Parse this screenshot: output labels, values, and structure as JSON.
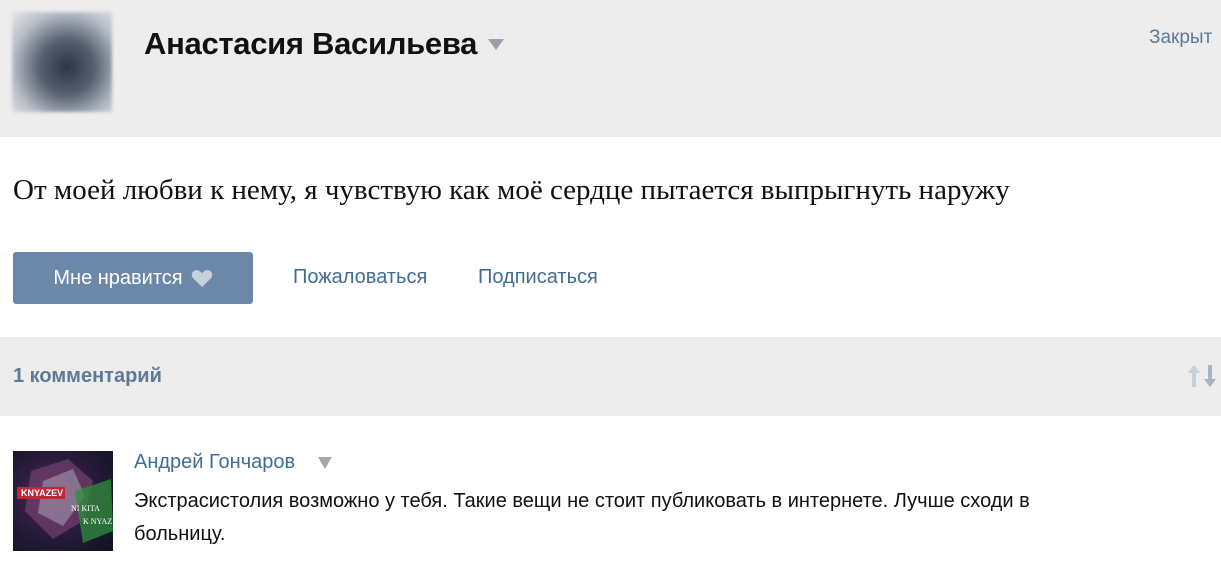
{
  "post": {
    "author": "Анастасия Васильева",
    "close_label": "Закрыт",
    "text": "От моей любви к нему, я чувствую как моё сердце пытается выпрыгнуть наружу",
    "like_label": "Мне нравится",
    "report_label": "Пожаловаться",
    "subscribe_label": "Подписаться"
  },
  "comments": {
    "count_label": "1 комментарий",
    "items": [
      {
        "author": "Андрей Гончаров",
        "avatar_text": [
          "KNYAZEV",
          "NI KITA",
          "K NYAZ"
        ],
        "text": "Экстрасистолия возможно у тебя. Такие вещи не стоит публиковать в интернете. Лучше сходи в больницу."
      }
    ]
  },
  "colors": {
    "header_bg": "#ededed",
    "like_button_bg": "#6b88a9",
    "link": "#416c96"
  },
  "icons": {
    "heart": "heart-icon",
    "sort": "sort-arrows-icon",
    "dropdown": "chevron-down-icon"
  }
}
